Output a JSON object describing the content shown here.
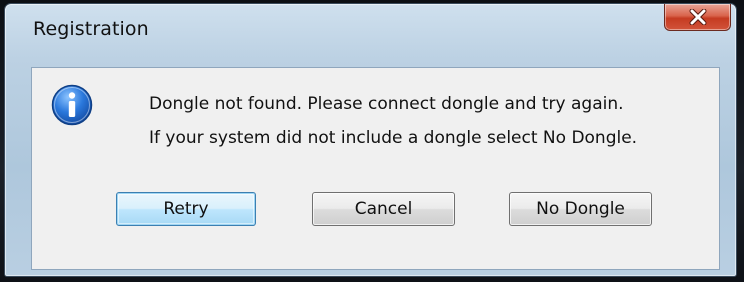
{
  "window": {
    "title": "Registration"
  },
  "dialog": {
    "icon": "information-icon",
    "message_line1": "Dongle not found. Please connect dongle and try again.",
    "message_line2": "If your system did not include a dongle select No Dongle."
  },
  "buttons": {
    "retry": "Retry",
    "cancel": "Cancel",
    "no_dongle": "No Dongle"
  },
  "colors": {
    "close_button": "#d2543a",
    "default_button_border": "#3c7fb1",
    "info_icon": "#1f63c6"
  }
}
